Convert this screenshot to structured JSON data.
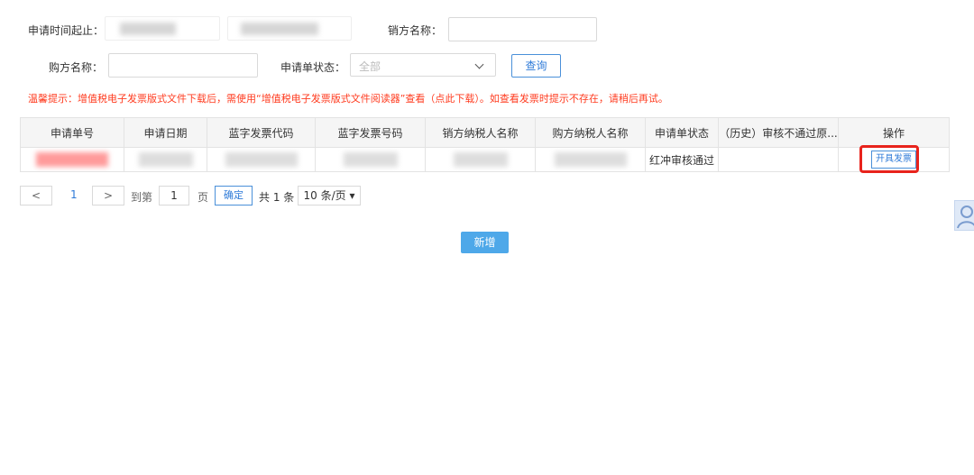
{
  "filters": {
    "apply_time_label": "申请时间起止：",
    "seller_name_label": "销方名称：",
    "buyer_name_label": "购方名称：",
    "status_label": "申请单状态：",
    "status_value": "全部",
    "query_button": "查询"
  },
  "tip": "温馨提示：增值税电子发票版式文件下载后，需使用“增值税电子发票版式文件阅读器”查看（点此下载）。如查看发票时提示不存在，请稍后再试。",
  "table": {
    "headers": [
      "申请单号",
      "申请日期",
      "蓝字发票代码",
      "蓝字发票号码",
      "销方纳税人名称",
      "购方纳税人名称",
      "申请单状态",
      "（历史）审核不通过原...",
      "操作"
    ],
    "row": {
      "status": "红冲审核通过",
      "action_button": "开具发票"
    }
  },
  "pagination": {
    "prev": "<",
    "current_page": "1",
    "next": ">",
    "goto_label": "到第",
    "goto_value": "1",
    "page_unit": "页",
    "confirm": "确定",
    "total": "共 1 条",
    "page_size": "10 条/页 ▾"
  },
  "add_button": "新增",
  "colors": {
    "tip_red": "#ff3b1f",
    "highlight_red": "#e8231c",
    "primary_blue": "#4ea8e9",
    "link_blue": "#2f7bd8"
  },
  "side_icon": "user-icon"
}
